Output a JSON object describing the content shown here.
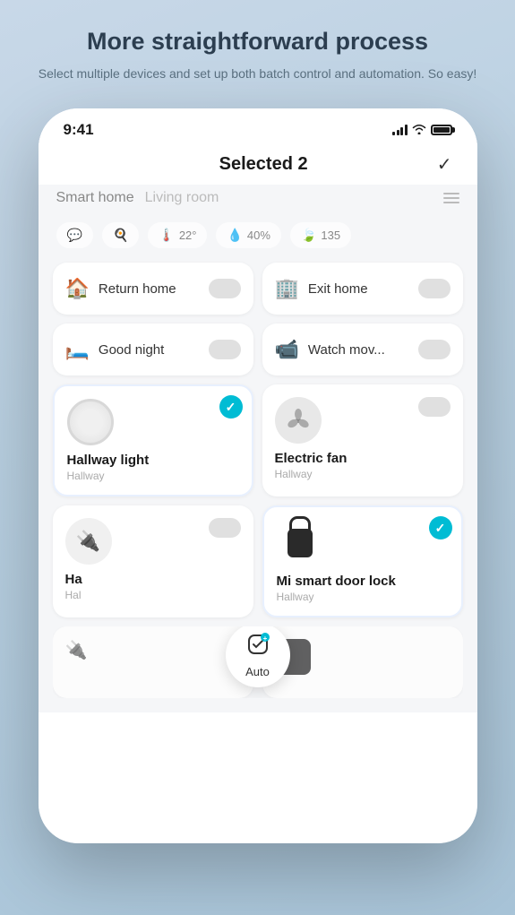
{
  "header": {
    "title": "More straightforward process",
    "subtitle": "Select multiple devices and set up both batch control and automation. So easy!"
  },
  "statusBar": {
    "time": "9:41"
  },
  "appBar": {
    "title": "Selected 2",
    "checkmark": "✓"
  },
  "tabs": {
    "smartHome": "Smart home",
    "livingRoom": "Living room"
  },
  "sensors": [
    {
      "icon": "💬",
      "value": ""
    },
    {
      "icon": "🍳",
      "value": ""
    },
    {
      "icon": "🌡️",
      "value": "22°"
    },
    {
      "icon": "💧",
      "value": "40%"
    },
    {
      "icon": "🍃",
      "value": "135"
    }
  ],
  "scenes": [
    {
      "icon": "🏠",
      "label": "Return home"
    },
    {
      "icon": "🏢",
      "label": "Exit home"
    }
  ],
  "scenes2": [
    {
      "icon": "🛏️",
      "label": "Good night"
    },
    {
      "icon": "📹",
      "label": "Watch mov..."
    }
  ],
  "devices": [
    {
      "name": "Hallway light",
      "location": "Hallway",
      "selected": true,
      "type": "light"
    },
    {
      "name": "Electric fan",
      "location": "Hallway",
      "selected": false,
      "type": "fan"
    },
    {
      "name": "Ha",
      "location": "Hal",
      "selected": false,
      "type": "socket",
      "partial": true
    },
    {
      "name": "Mi smart door lock",
      "location": "Hallway",
      "selected": true,
      "type": "lock"
    }
  ],
  "auto": {
    "label": "Auto"
  },
  "colors": {
    "teal": "#00bcd4",
    "background": "#b8cfe0"
  }
}
